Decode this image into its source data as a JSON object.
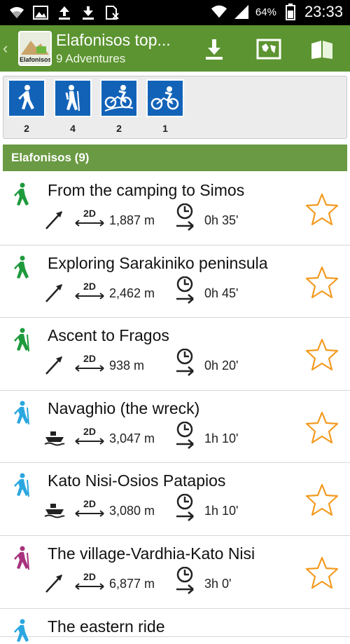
{
  "status_bar": {
    "battery": "64%",
    "time": "23:33"
  },
  "action_bar": {
    "logo_text": "Elafonisos",
    "title": "Elafonisos top...",
    "subtitle": "9 Adventures"
  },
  "filters": [
    {
      "icon": "hiking-icon",
      "count": "2"
    },
    {
      "icon": "trekking-icon",
      "count": "4"
    },
    {
      "icon": "mountain-bike-icon",
      "count": "2"
    },
    {
      "icon": "cycling-icon",
      "count": "1"
    }
  ],
  "section": {
    "title": "Elafonisos (9)"
  },
  "adventures": [
    {
      "title": "From the camping to Simos",
      "activity": "hiking",
      "color": "#1e9a3c",
      "type": "arrow",
      "mode": "2D",
      "distance": "1,887 m",
      "duration": "0h 35'"
    },
    {
      "title": "Exploring Sarakiniko peninsula",
      "activity": "hiking",
      "color": "#1e9a3c",
      "type": "arrow",
      "mode": "2D",
      "distance": "2,462 m",
      "duration": "0h 45'"
    },
    {
      "title": "Ascent to Fragos",
      "activity": "trekking",
      "color": "#1e9a3c",
      "type": "arrow",
      "mode": "2D",
      "distance": "938 m",
      "duration": "0h 20'"
    },
    {
      "title": "Navaghio (the wreck)",
      "activity": "trekking",
      "color": "#2aa7e0",
      "type": "boat",
      "mode": "2D",
      "distance": "3,047 m",
      "duration": "1h 10'"
    },
    {
      "title": "Kato Nisi-Osios Patapios",
      "activity": "trekking",
      "color": "#2aa7e0",
      "type": "boat",
      "mode": "2D",
      "distance": "3,080 m",
      "duration": "1h 10'"
    },
    {
      "title": "The village-Vardhia-Kato Nisi",
      "activity": "trekking",
      "color": "#a8327e",
      "type": "arrow",
      "mode": "2D",
      "distance": "6,877 m",
      "duration": "3h 0'"
    }
  ],
  "partial_row": {
    "title": "The eastern ride",
    "color": "#2aa7e0"
  },
  "colors": {
    "action_bar": "#5c9431",
    "section_header": "#6a9a44",
    "filter_tile": "#1263b8",
    "star": "#f39a1f"
  }
}
